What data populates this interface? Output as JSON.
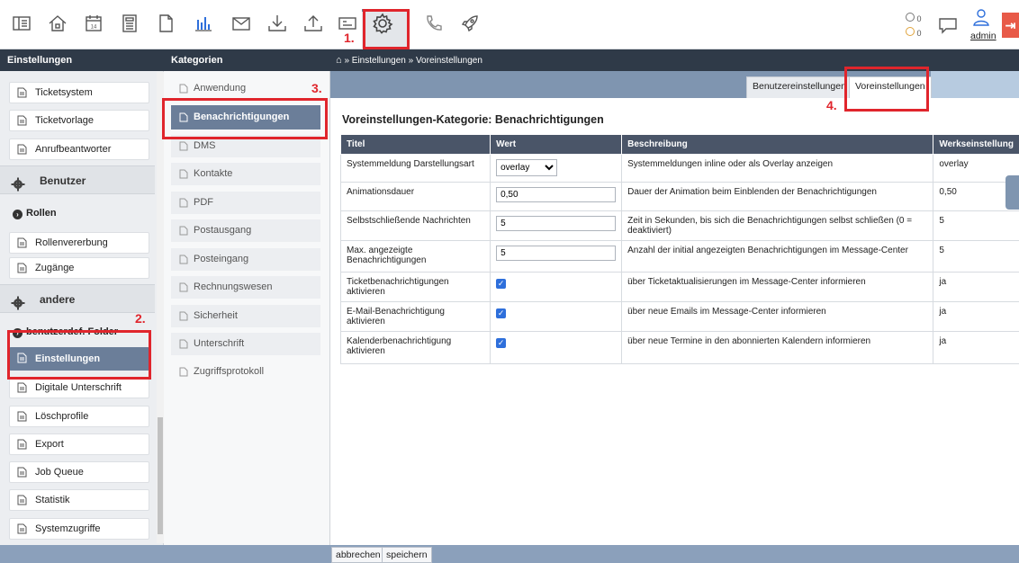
{
  "toolbar": {
    "icons": [
      "dashboard-icon",
      "home-icon",
      "calendar-icon",
      "calculator-icon",
      "document-icon",
      "chart-icon",
      "mail-icon",
      "download-icon",
      "upload-icon",
      "ticket-icon",
      "gear-icon",
      "phone-icon",
      "rocket-icon"
    ],
    "calendar_day": "14",
    "notif_count_1": "0",
    "notif_count_2": "0",
    "user": "admin"
  },
  "headers": {
    "settings": "Einstellungen",
    "categories": "Kategorien",
    "breadcrumb": "» Einstellungen » Voreinstellungen"
  },
  "sidebar": {
    "items": {
      "ticketsystem": "Ticketsystem",
      "ticketvorlage": "Ticketvorlage",
      "anrufbeantworter": "Anrufbeantworter",
      "group_benutzer": "Benutzer",
      "rollen": "Rollen",
      "rollenvererbung": "Rollenvererbung",
      "zugaenge": "Zugänge",
      "group_andere": "andere",
      "benutzerdef_folder": "benutzerdef. Folder",
      "einstellungen": "Einstellungen",
      "digitale_unterschrift": "Digitale Unterschrift",
      "loeschprofile": "Löschprofile",
      "export": "Export",
      "job_queue": "Job Queue",
      "statistik": "Statistik",
      "systemzugriffe": "Systemzugriffe"
    }
  },
  "categories": {
    "anwendung": "Anwendung",
    "benachrichtigungen": "Benachrichtigungen",
    "dms": "DMS",
    "kontakte": "Kontakte",
    "pdf": "PDF",
    "postausgang": "Postausgang",
    "posteingang": "Posteingang",
    "rechnungswesen": "Rechnungswesen",
    "sicherheit": "Sicherheit",
    "unterschrift": "Unterschrift",
    "zugriffsprotokoll": "Zugriffsprotokoll"
  },
  "tabs": {
    "benutzer": "Benutzereinstellungen",
    "vor": "Voreinstellungen"
  },
  "page_title": "Voreinstellungen-Kategorie: Benachrichtigungen",
  "table": {
    "headers": {
      "titel": "Titel",
      "wert": "Wert",
      "beschreibung": "Beschreibung",
      "werk": "Werkseinstellung"
    },
    "rows": [
      {
        "titel": "Systemmeldung Darstellungsart",
        "wert": "overlay",
        "beschreibung": "Systemmeldungen inline oder als Overlay anzeigen",
        "werk": "overlay"
      },
      {
        "titel": "Animationsdauer",
        "wert": "0,50",
        "beschreibung": "Dauer der Animation beim Einblenden der Benachrichtigungen",
        "werk": "0,50"
      },
      {
        "titel": "Selbstschließende Nachrichten",
        "wert": "5",
        "beschreibung": "Zeit in Sekunden, bis sich die Benachrichtigungen selbst schließen (0 = deaktiviert)",
        "werk": "5"
      },
      {
        "titel": "Max. angezeigte Benachrichtigungen",
        "wert": "5",
        "beschreibung": "Anzahl der initial angezeigten Benachrichtigungen im Message-Center",
        "werk": "5"
      },
      {
        "titel": "Ticketbenachrichtigungen aktivieren",
        "wert": "checked",
        "beschreibung": "über Ticketaktualisierungen im Message-Center informieren",
        "werk": "ja"
      },
      {
        "titel": "E-Mail-Benachrichtigung aktivieren",
        "wert": "checked",
        "beschreibung": "über neue Emails im Message-Center informieren",
        "werk": "ja"
      },
      {
        "titel": "Kalenderbenachrichtigung aktivieren",
        "wert": "checked",
        "beschreibung": "über neue Termine in den abonnierten Kalendern informieren",
        "werk": "ja"
      }
    ]
  },
  "buttons": {
    "cancel": "abbrechen",
    "save": "speichern"
  },
  "annotations": {
    "n1": "1.",
    "n2": "2.",
    "n3": "3.",
    "n4": "4."
  },
  "colors": {
    "accent": "#6b7e99",
    "header_dark": "#2f3a48",
    "annotation_red": "#e0252c",
    "checkbox": "#2e6fdb"
  }
}
